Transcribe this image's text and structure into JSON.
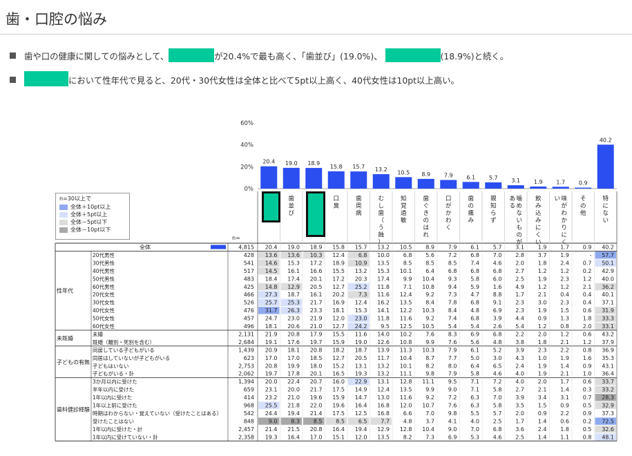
{
  "page": {
    "title": "歯・口腔の悩み",
    "bullet1_a": "歯や口の健康に関しての悩みとして、",
    "bullet1_b": "が20.4%で最も高く、「歯並び」(19.0%)、",
    "bullet1_c": "(18.9%)と続く。",
    "bullet2_b": "において性年代で見ると、20代・30代女性は全体と比べて5pt以上高く、40代女性は10pt以上高い。"
  },
  "legend": {
    "title": "n=30以上で",
    "items": [
      {
        "label": "全体＋10pt以上",
        "color": "#8ea9ee"
      },
      {
        "label": "全体＋5pt以上",
        "color": "#d6e0fb"
      },
      {
        "label": "全体－5pt以下",
        "color": "#dcdcdc"
      },
      {
        "label": "全体－10pt以下",
        "color": "#a8a8a8"
      }
    ]
  },
  "colors": {
    "bar": "#2a4ef0",
    "plus10": "#8ea9ee",
    "plus5": "#d6e0fb",
    "minus5": "#dcdcdc",
    "minus10": "#a8a8a8"
  },
  "chart_data": {
    "type": "bar",
    "ylim": [
      0,
      60
    ],
    "yticks": [
      "0%",
      "20%",
      "40%",
      "60%"
    ],
    "n_label": "n=",
    "categories": [
      "",
      "歯並び",
      "",
      "口臭",
      "歯周病",
      "むし歯（う蝕）",
      "知覚過敏",
      "歯ぐきのはれ",
      "口がかわく",
      "歯の痛み",
      "親知らず",
      "噛めないものがある",
      "飲み込みにくい",
      "味がわかりにくい",
      "その他",
      "特にない"
    ],
    "values": [
      20.4,
      19.0,
      18.9,
      15.8,
      15.7,
      13.2,
      10.5,
      8.9,
      7.9,
      6.1,
      5.7,
      3.1,
      1.9,
      1.7,
      0.9,
      40.2
    ],
    "table_rows": [
      {
        "group": "",
        "label": "全体",
        "n": "4,815",
        "vals": [
          "20.4",
          "19.0",
          "18.9",
          "15.8",
          "15.7",
          "13.2",
          "10.5",
          "8.9",
          "7.9",
          "6.1",
          "5.7",
          "3.1",
          "1.9",
          "1.7",
          "0.9",
          "40.2"
        ],
        "hl": [
          0,
          0,
          0,
          0,
          0,
          0,
          0,
          0,
          0,
          0,
          0,
          0,
          0,
          0,
          0,
          0
        ]
      },
      {
        "group": "性年代",
        "label": "20代男性",
        "n": "428",
        "vals": [
          "13.6",
          "13.6",
          "10.3",
          "12.4",
          "6.8",
          "10.0",
          "6.8",
          "5.6",
          "7.2",
          "6.8",
          "7.0",
          "2.8",
          "3.7",
          "1.9",
          "-",
          "57.7"
        ],
        "hl": [
          -1,
          -1,
          -1,
          0,
          -1,
          0,
          0,
          0,
          0,
          0,
          0,
          0,
          0,
          0,
          0,
          2
        ]
      },
      {
        "group": "",
        "label": "30代男性",
        "n": "541",
        "vals": [
          "14.6",
          "15.3",
          "17.2",
          "18.9",
          "10.9",
          "13.5",
          "8.5",
          "8.5",
          "8.5",
          "7.4",
          "4.6",
          "2.0",
          "1.8",
          "2.4",
          "0.7",
          "50.1"
        ],
        "hl": [
          -1,
          0,
          0,
          0,
          -1,
          0,
          0,
          0,
          0,
          0,
          0,
          0,
          0,
          0,
          0,
          1
        ]
      },
      {
        "group": "",
        "label": "40代男性",
        "n": "517",
        "vals": [
          "14.5",
          "16.1",
          "16.6",
          "15.5",
          "13.2",
          "15.3",
          "10.1",
          "6.4",
          "6.8",
          "6.8",
          "6.8",
          "2.7",
          "1.2",
          "1.2",
          "0.2",
          "42.9"
        ],
        "hl": [
          -1,
          0,
          0,
          0,
          0,
          0,
          0,
          0,
          0,
          0,
          0,
          0,
          0,
          0,
          0,
          0
        ]
      },
      {
        "group": "",
        "label": "50代男性",
        "n": "483",
        "vals": [
          "18.4",
          "17.4",
          "20.1",
          "17.2",
          "20.3",
          "17.4",
          "9.9",
          "10.4",
          "9.3",
          "5.8",
          "6.0",
          "2.5",
          "1.9",
          "2.3",
          "1.2",
          "40.0"
        ],
        "hl": [
          0,
          0,
          0,
          0,
          0,
          0,
          0,
          0,
          0,
          0,
          0,
          0,
          0,
          0,
          0,
          0
        ]
      },
      {
        "group": "",
        "label": "60代男性",
        "n": "425",
        "vals": [
          "14.8",
          "12.9",
          "20.5",
          "12.7",
          "25.2",
          "11.8",
          "7.1",
          "10.8",
          "9.4",
          "5.9",
          "1.6",
          "4.9",
          "1.2",
          "1.2",
          "2.1",
          "36.2"
        ],
        "hl": [
          -1,
          -1,
          0,
          0,
          1,
          0,
          0,
          0,
          0,
          0,
          0,
          0,
          0,
          0,
          0,
          -1
        ]
      },
      {
        "group": "",
        "label": "20代女性",
        "n": "466",
        "vals": [
          "27.3",
          "18.7",
          "16.1",
          "20.2",
          "7.3",
          "11.6",
          "12.4",
          "9.2",
          "7.3",
          "4.7",
          "8.8",
          "1.7",
          "2.1",
          "0.4",
          "0.4",
          "40.1"
        ],
        "hl": [
          1,
          0,
          0,
          0,
          -1,
          0,
          0,
          0,
          0,
          0,
          0,
          0,
          0,
          0,
          0,
          0
        ]
      },
      {
        "group": "",
        "label": "30代女性",
        "n": "526",
        "vals": [
          "25.7",
          "25.3",
          "21.7",
          "16.9",
          "12.4",
          "16.2",
          "13.5",
          "8.4",
          "7.8",
          "6.8",
          "9.1",
          "2.3",
          "3.0",
          "2.3",
          "0.4",
          "37.1"
        ],
        "hl": [
          1,
          1,
          0,
          0,
          0,
          0,
          0,
          0,
          0,
          0,
          0,
          0,
          0,
          0,
          0,
          0
        ]
      },
      {
        "group": "",
        "label": "40代女性",
        "n": "476",
        "vals": [
          "31.7",
          "26.3",
          "23.3",
          "18.1",
          "15.3",
          "14.1",
          "12.2",
          "10.3",
          "8.4",
          "4.8",
          "6.9",
          "2.3",
          "1.9",
          "1.5",
          "0.6",
          "31.9"
        ],
        "hl": [
          2,
          1,
          0,
          0,
          0,
          0,
          0,
          0,
          0,
          0,
          0,
          0,
          0,
          0,
          0,
          -1
        ]
      },
      {
        "group": "",
        "label": "50代女性",
        "n": "457",
        "vals": [
          "24.7",
          "23.0",
          "21.9",
          "12.0",
          "23.0",
          "11.8",
          "11.6",
          "9.2",
          "7.4",
          "6.8",
          "3.9",
          "4.4",
          "0.9",
          "1.3",
          "1.8",
          "33.3"
        ],
        "hl": [
          0,
          0,
          0,
          0,
          1,
          0,
          0,
          0,
          0,
          0,
          0,
          0,
          0,
          0,
          0,
          -1
        ]
      },
      {
        "group": "",
        "label": "60代女性",
        "n": "496",
        "vals": [
          "18.1",
          "20.6",
          "21.0",
          "12.7",
          "24.2",
          "9.5",
          "12.5",
          "10.5",
          "5.4",
          "5.4",
          "2.6",
          "5.4",
          "1.2",
          "0.8",
          "2.0",
          "33.1"
        ],
        "hl": [
          0,
          0,
          0,
          0,
          1,
          0,
          0,
          0,
          0,
          0,
          0,
          0,
          0,
          0,
          0,
          -1
        ]
      },
      {
        "group": "未既婚",
        "label": "未婚",
        "n": "2,131",
        "vals": [
          "21.9",
          "20.8",
          "17.9",
          "15.5",
          "11.6",
          "14.0",
          "10.2",
          "7.6",
          "8.3",
          "6.9",
          "6.8",
          "2.2",
          "2.0",
          "1.2",
          "0.6",
          "43.2"
        ],
        "hl": [
          0,
          0,
          0,
          0,
          0,
          0,
          0,
          0,
          0,
          0,
          0,
          0,
          0,
          0,
          0,
          0
        ]
      },
      {
        "group": "",
        "label": "既婚（離別・死別を含む）",
        "n": "2,684",
        "vals": [
          "19.1",
          "17.6",
          "19.7",
          "15.9",
          "19.0",
          "12.6",
          "10.8",
          "9.9",
          "7.6",
          "5.6",
          "4.8",
          "3.8",
          "1.8",
          "2.1",
          "1.2",
          "37.9"
        ],
        "hl": [
          0,
          0,
          0,
          0,
          0,
          0,
          0,
          0,
          0,
          0,
          0,
          0,
          0,
          0,
          0,
          0
        ]
      },
      {
        "group": "子どもの有無",
        "label": "同居している子どもがいる",
        "n": "1,439",
        "vals": [
          "20.9",
          "18.1",
          "20.8",
          "18.2",
          "18.7",
          "13.9",
          "11.3",
          "10.3",
          "7.9",
          "6.1",
          "5.2",
          "3.9",
          "2.3",
          "2.2",
          "0.8",
          "36.9"
        ],
        "hl": [
          0,
          0,
          0,
          0,
          0,
          0,
          0,
          0,
          0,
          0,
          0,
          0,
          0,
          0,
          0,
          0
        ]
      },
      {
        "group": "",
        "label": "同居はしていないが子どもがいる",
        "n": "623",
        "vals": [
          "17.0",
          "17.0",
          "18.5",
          "12.7",
          "20.5",
          "11.7",
          "10.4",
          "8.7",
          "7.7",
          "5.0",
          "3.0",
          "4.3",
          "1.0",
          "1.9",
          "1.6",
          "35.3"
        ],
        "hl": [
          0,
          0,
          0,
          0,
          0,
          0,
          0,
          0,
          0,
          0,
          0,
          0,
          0,
          0,
          0,
          0
        ]
      },
      {
        "group": "",
        "label": "子どもはいない",
        "n": "2,753",
        "vals": [
          "20.8",
          "19.9",
          "18.0",
          "15.2",
          "13.1",
          "13.2",
          "10.1",
          "8.2",
          "8.0",
          "6.4",
          "6.5",
          "2.4",
          "1.9",
          "1.4",
          "0.9",
          "43.1"
        ],
        "hl": [
          0,
          0,
          0,
          0,
          0,
          0,
          0,
          0,
          0,
          0,
          0,
          0,
          0,
          0,
          0,
          0
        ]
      },
      {
        "group": "",
        "label": "子どもがいる・計",
        "n": "2,062",
        "vals": [
          "19.7",
          "17.8",
          "20.1",
          "16.5",
          "19.3",
          "13.2",
          "11.1",
          "9.8",
          "7.9",
          "5.8",
          "4.6",
          "4.0",
          "1.9",
          "2.1",
          "1.0",
          "36.4"
        ],
        "hl": [
          0,
          0,
          0,
          0,
          0,
          0,
          0,
          0,
          0,
          0,
          0,
          0,
          0,
          0,
          0,
          0
        ]
      },
      {
        "group": "歯科健診経験",
        "label": "3か月以内に受けた",
        "n": "1,394",
        "vals": [
          "20.0",
          "22.4",
          "20.7",
          "16.0",
          "22.9",
          "13.1",
          "12.8",
          "11.1",
          "9.5",
          "7.1",
          "7.2",
          "4.0",
          "2.0",
          "1.7",
          "0.6",
          "33.7"
        ],
        "hl": [
          0,
          0,
          0,
          0,
          1,
          0,
          0,
          0,
          0,
          0,
          0,
          0,
          0,
          0,
          0,
          -1
        ]
      },
      {
        "group": "",
        "label": "半年以内に受けた",
        "n": "659",
        "vals": [
          "23.1",
          "20.0",
          "21.7",
          "17.5",
          "14.9",
          "12.4",
          "13.5",
          "9.9",
          "9.0",
          "7.1",
          "5.8",
          "2.7",
          "2.1",
          "1.4",
          "0.3",
          "33.2"
        ],
        "hl": [
          0,
          0,
          0,
          0,
          0,
          0,
          0,
          0,
          0,
          0,
          0,
          0,
          0,
          0,
          0,
          -1
        ]
      },
      {
        "group": "",
        "label": "1年以内に受けた",
        "n": "414",
        "vals": [
          "23.2",
          "21.0",
          "19.6",
          "15.9",
          "14.7",
          "13.0",
          "11.6",
          "9.2",
          "7.2",
          "6.3",
          "7.0",
          "3.9",
          "3.4",
          "3.1",
          "0.7",
          "28.3"
        ],
        "hl": [
          0,
          0,
          0,
          0,
          0,
          0,
          0,
          0,
          0,
          0,
          0,
          0,
          0,
          0,
          0,
          -2
        ]
      },
      {
        "group": "",
        "label": "1年以上前に受けた",
        "n": "968",
        "vals": [
          "25.5",
          "21.8",
          "22.0",
          "19.6",
          "16.4",
          "16.8",
          "12.0",
          "10.7",
          "7.6",
          "6.3",
          "5.8",
          "3.5",
          "1.5",
          "0.9",
          "0.5",
          "32.9"
        ],
        "hl": [
          1,
          0,
          0,
          0,
          0,
          0,
          0,
          0,
          0,
          0,
          0,
          0,
          0,
          0,
          0,
          -1
        ]
      },
      {
        "group": "",
        "label": "時期はわからない・覚えていない（受けたことはある）",
        "n": "542",
        "vals": [
          "24.4",
          "19.4",
          "21.4",
          "17.5",
          "12.5",
          "16.8",
          "6.6",
          "7.0",
          "9.8",
          "5.5",
          "5.7",
          "2.0",
          "0.9",
          "2.2",
          "0.9",
          "37.3"
        ],
        "hl": [
          0,
          0,
          0,
          0,
          0,
          0,
          0,
          0,
          0,
          0,
          0,
          0,
          0,
          0,
          0,
          0
        ]
      },
      {
        "group": "",
        "label": "受けたことはない",
        "n": "848",
        "vals": [
          "9.0",
          "8.3",
          "8.5",
          "8.5",
          "6.5",
          "7.7",
          "4.8",
          "3.7",
          "4.1",
          "4.0",
          "2.5",
          "1.7",
          "1.4",
          "0.6",
          "0.2",
          "72.5"
        ],
        "hl": [
          -2,
          -2,
          -2,
          -1,
          -1,
          -1,
          0,
          0,
          0,
          0,
          0,
          0,
          0,
          0,
          0,
          2
        ]
      },
      {
        "group": "",
        "label": "1年以内に受けた・計",
        "n": "2,457",
        "vals": [
          "21.4",
          "21.5",
          "20.8",
          "16.4",
          "19.4",
          "12.9",
          "12.8",
          "10.4",
          "9.0",
          "7.0",
          "6.8",
          "3.6",
          "2.4",
          "1.8",
          "0.5",
          "32.6"
        ],
        "hl": [
          0,
          0,
          0,
          0,
          0,
          0,
          0,
          0,
          0,
          0,
          0,
          0,
          0,
          0,
          0,
          -1
        ]
      },
      {
        "group": "",
        "label": "1年以内に受けていない・計",
        "n": "2,358",
        "vals": [
          "19.3",
          "16.4",
          "17.0",
          "15.1",
          "12.0",
          "13.5",
          "8.2",
          "7.3",
          "6.9",
          "5.3",
          "4.6",
          "2.5",
          "1.4",
          "1.1",
          "0.8",
          "48.1"
        ],
        "hl": [
          0,
          0,
          0,
          0,
          0,
          0,
          0,
          0,
          0,
          0,
          0,
          0,
          0,
          0,
          0,
          1
        ]
      }
    ]
  }
}
